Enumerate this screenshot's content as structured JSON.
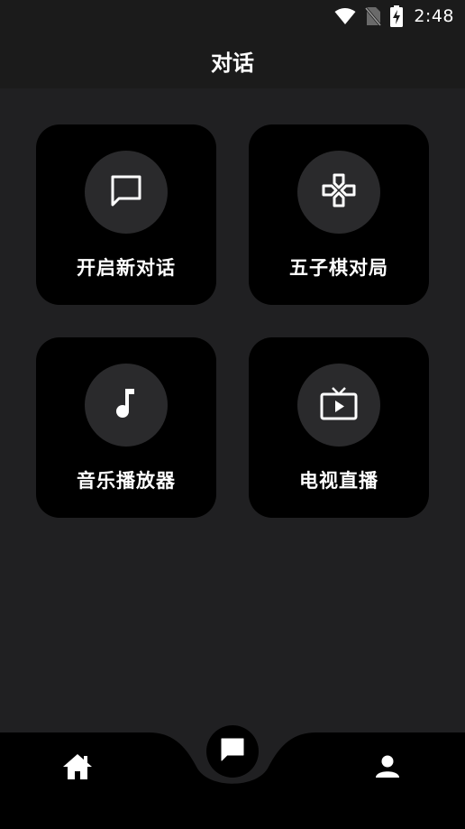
{
  "status_bar": {
    "time": "2:48",
    "icons": [
      "wifi-icon",
      "no-sim-icon",
      "battery-charging-icon"
    ]
  },
  "app_bar": {
    "title": "对话"
  },
  "cards": [
    {
      "label": "开启新对话",
      "icon": "chat-bubble-icon"
    },
    {
      "label": "五子棋对局",
      "icon": "gamepad-icon"
    },
    {
      "label": "音乐播放器",
      "icon": "music-note-icon"
    },
    {
      "label": "电视直播",
      "icon": "tv-icon"
    }
  ],
  "bottom_nav": {
    "items": [
      "home-icon",
      "chat-icon",
      "person-icon"
    ],
    "selected": "chat-icon"
  },
  "colors": {
    "background": "#202022",
    "app_bar": "#1b1b1b",
    "card": "#000000",
    "icon_circle": "#2a2a2c",
    "text": "#ffffff"
  }
}
